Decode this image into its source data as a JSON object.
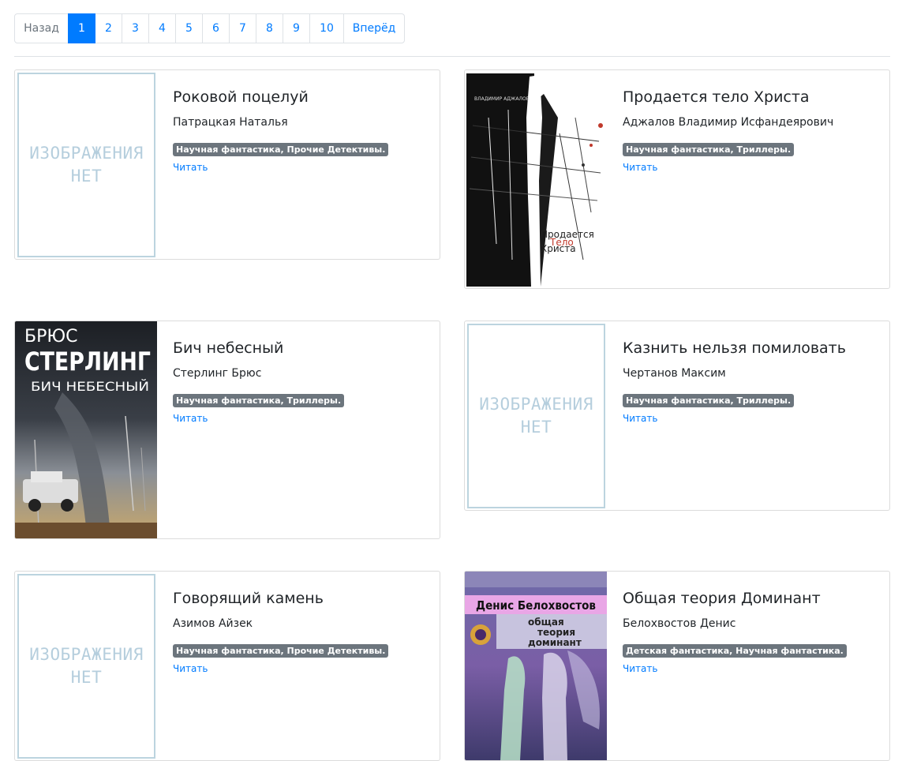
{
  "pagination": {
    "prev": "Назад",
    "pages": [
      "1",
      "2",
      "3",
      "4",
      "5",
      "6",
      "7",
      "8",
      "9",
      "10"
    ],
    "active_page": "1",
    "next": "Вперёд"
  },
  "placeholder": {
    "line1": "ИЗОБРАЖЕНИЯ",
    "line2": "НЕТ"
  },
  "read_label": "Читать",
  "books": [
    {
      "title": "Роковой поцелуй",
      "author": "Патрацкая Наталья",
      "genres": "Научная фантастика, Прочие Детективы.",
      "cover": "none"
    },
    {
      "title": "Продается тело Христа",
      "author": "Аджалов Владимир Исфандеярович",
      "genres": "Научная фантастика, Триллеры.",
      "cover": "image",
      "cover_text": {
        "author": "ВЛАДИМИР АДЖАЛОВ",
        "title_1": "Продается",
        "title_2": "Тело",
        "title_3": "Христа"
      }
    },
    {
      "title": "Бич небесный",
      "author": "Стерлинг Брюс",
      "genres": "Научная фантастика, Триллеры.",
      "cover": "image",
      "cover_text": {
        "author_first": "БРЮС",
        "author_last": "СТЕРЛИНГ",
        "title": "БИЧ НЕБЕСНЫЙ"
      }
    },
    {
      "title": "Казнить нельзя помиловать",
      "author": "Чертанов Максим",
      "genres": "Научная фантастика, Триллеры.",
      "cover": "none"
    },
    {
      "title": "Говорящий камень",
      "author": "Азимов Айзек",
      "genres": "Научная фантастика, Прочие Детективы.",
      "cover": "none"
    },
    {
      "title": "Общая теория Доминант",
      "author": "Белохвостов Денис",
      "genres": "Детская фантастика, Научная фантастика.",
      "cover": "image",
      "cover_text": {
        "author": "Денис Белохвостов",
        "title_1": "общая",
        "title_2": "теория",
        "title_3": "доминант"
      }
    }
  ],
  "colors": {
    "link": "#007bff",
    "badge": "#6c757d",
    "placeholder_border": "#bcd4df",
    "placeholder_text": "#b5cedd"
  }
}
